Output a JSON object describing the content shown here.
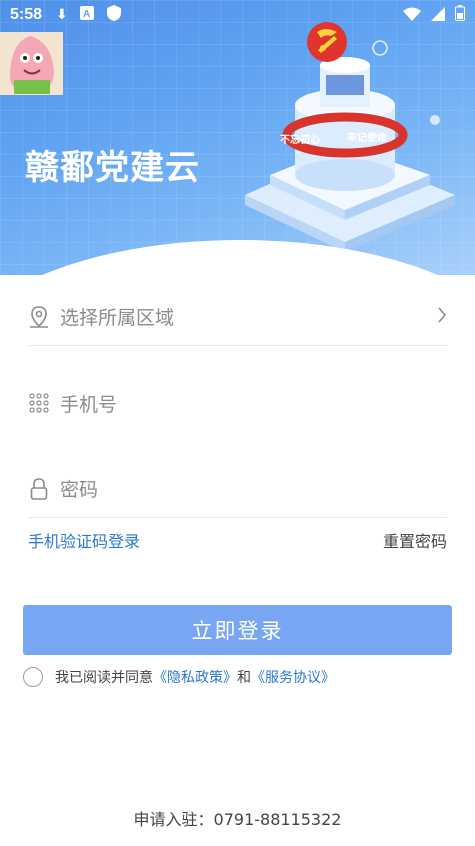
{
  "status_bar": {
    "time": "5:58",
    "icons_left": [
      "download-icon",
      "font-icon",
      "shield-icon"
    ],
    "icons_right": [
      "wifi-icon",
      "signal-icon",
      "battery-icon"
    ]
  },
  "header": {
    "app_title": "赣鄱党建云",
    "banner_sign_text": [
      "不忘初心",
      "牢记使命"
    ]
  },
  "form": {
    "region": {
      "placeholder": "选择所属区域",
      "icon": "location-pin-icon"
    },
    "phone": {
      "placeholder": "手机号",
      "icon": "keypad-icon"
    },
    "password": {
      "placeholder": "密码",
      "icon": "lock-icon"
    }
  },
  "links": {
    "sms_login": "手机验证码登录",
    "reset_password": "重置密码"
  },
  "login_button": "立即登录",
  "agreement": {
    "prefix": "我已阅读并同意",
    "privacy": "《隐私政策》",
    "and": "和",
    "service": "《服务协议》"
  },
  "footer": {
    "contact": "申请入驻：0791-88115322"
  },
  "colors": {
    "accent": "#2878d2",
    "button": "#78a6f3",
    "banner": "#5fa2f2"
  }
}
